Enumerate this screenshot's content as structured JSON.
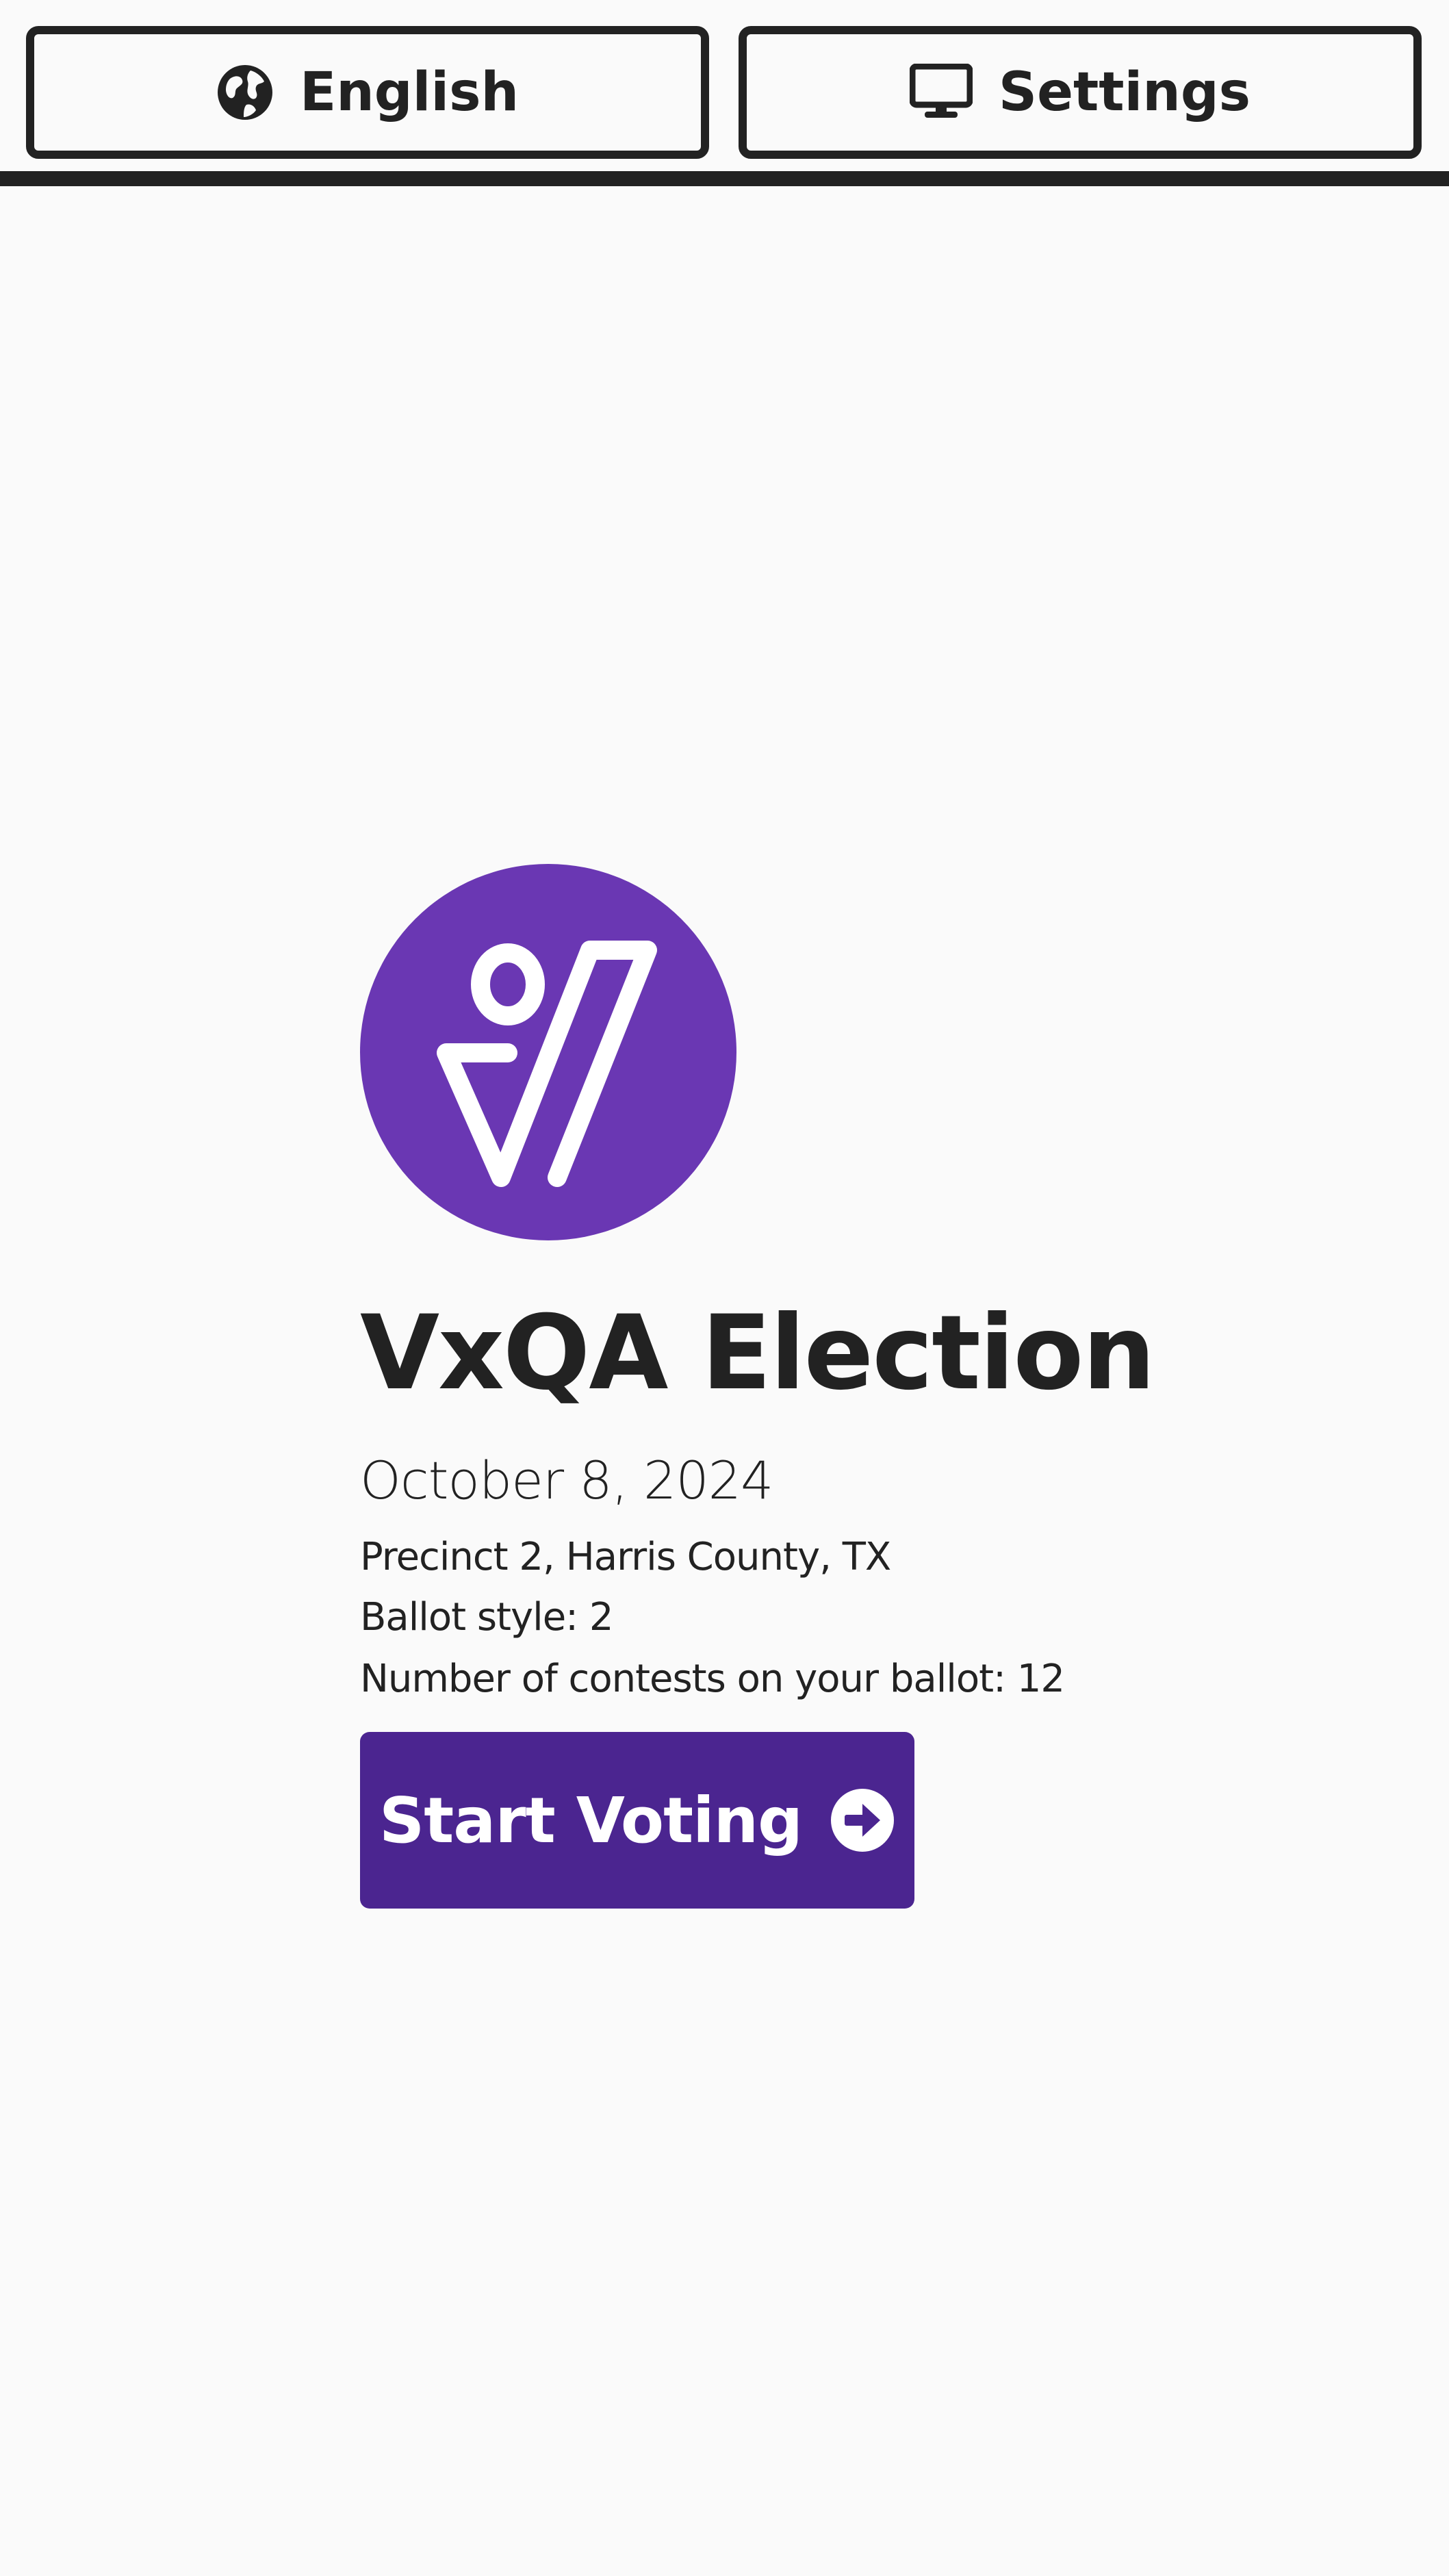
{
  "header": {
    "language_button": {
      "label": "English",
      "icon": "globe-icon"
    },
    "settings_button": {
      "label": "Settings",
      "icon": "monitor-icon"
    }
  },
  "election": {
    "logo": "vx-logo",
    "title": "VxQA Election",
    "date": "October 8, 2024",
    "precinct": "Precinct 2, Harris County, TX",
    "ballot_style": "Ballot style: 2",
    "contest_count": "Number of contests on your ballot: 12"
  },
  "actions": {
    "start_voting": {
      "label": "Start Voting",
      "icon": "arrow-circle-right-icon"
    }
  },
  "colors": {
    "brand_purple": "#6a37b3",
    "button_purple": "#4b2590",
    "ink": "#222222",
    "background": "#fafafa"
  }
}
